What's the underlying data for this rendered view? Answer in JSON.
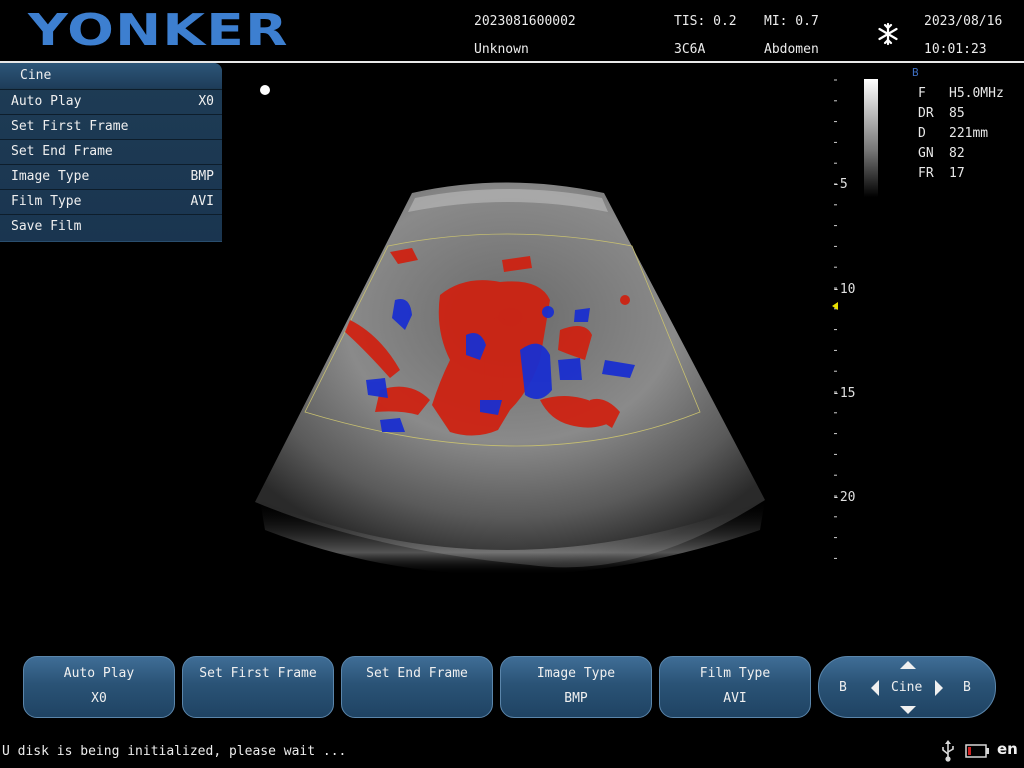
{
  "header": {
    "brand": "YONKER",
    "patient_id": "2023081600002",
    "patient_name": "Unknown",
    "tis": "TIS: 0.2",
    "probe": "3C6A",
    "mi": "MI: 0.7",
    "preset": "Abdomen",
    "date": "2023/08/16",
    "time": "10:01:23",
    "freeze_icon": "snowflake-icon"
  },
  "cine_menu": {
    "title": "Cine",
    "items": [
      {
        "label": "Auto Play",
        "value": "X0"
      },
      {
        "label": "Set First Frame",
        "value": ""
      },
      {
        "label": "Set End Frame",
        "value": ""
      },
      {
        "label": "Image Type",
        "value": "BMP"
      },
      {
        "label": "Film Type",
        "value": "AVI"
      },
      {
        "label": "Save Film",
        "value": ""
      }
    ]
  },
  "depth_scale": {
    "labels": [
      "-5",
      "-10",
      "-15",
      "-20"
    ]
  },
  "params": {
    "mode": "B",
    "rows": [
      {
        "key": "F",
        "value": "H5.0MHz"
      },
      {
        "key": "DR",
        "value": "85"
      },
      {
        "key": "D",
        "value": "221mm"
      },
      {
        "key": "GN",
        "value": "82"
      },
      {
        "key": "FR",
        "value": "17"
      }
    ]
  },
  "softkeys": [
    {
      "line1": "Auto Play",
      "line2": "X0"
    },
    {
      "line1": "Set First Frame",
      "line2": ""
    },
    {
      "line1": "Set End Frame",
      "line2": ""
    },
    {
      "line1": "Image Type",
      "line2": "BMP"
    },
    {
      "line1": "Film Type",
      "line2": "AVI"
    }
  ],
  "nav": {
    "left": "B",
    "center": "Cine",
    "right": "B"
  },
  "status": {
    "message": "U disk is being initialized, please wait ...",
    "language": "en"
  },
  "colors": {
    "brand": "#3d7fd0",
    "menu_bg": "#1e3c55",
    "button_bg": "#2a5376",
    "doppler_red": "#d0200f",
    "doppler_blue": "#1a2fd0"
  }
}
